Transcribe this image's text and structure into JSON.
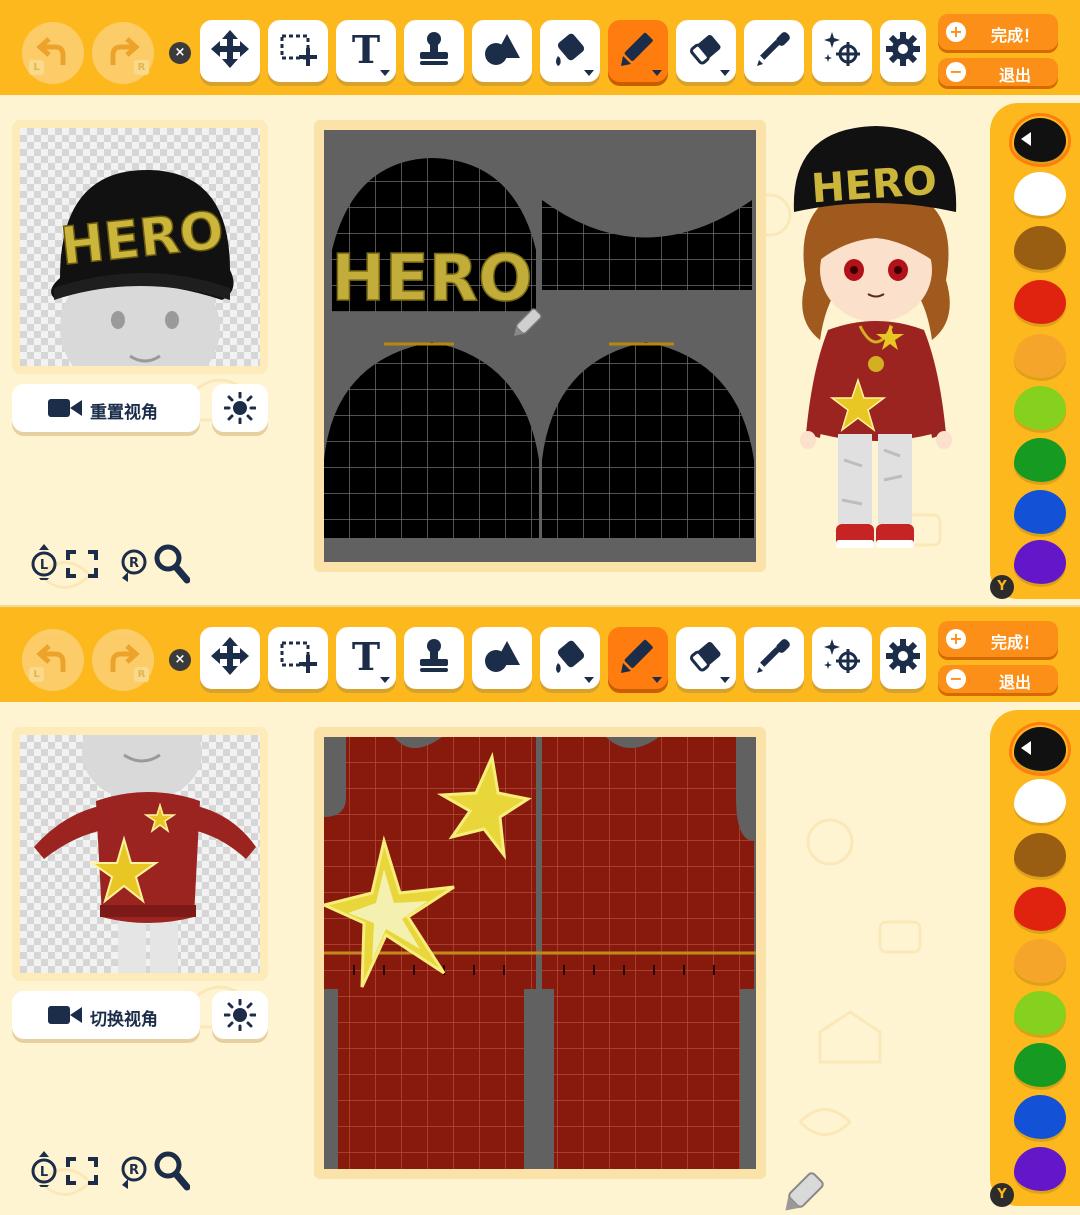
{
  "toolbar": {
    "close_glyph": "×",
    "undo_key": "L",
    "redo_key": "R",
    "tools": [
      {
        "icon": "move-icon"
      },
      {
        "icon": "select-area-icon"
      },
      {
        "icon": "text-icon",
        "glyph": "T"
      },
      {
        "icon": "stamp-icon"
      },
      {
        "icon": "shapes-icon"
      },
      {
        "icon": "fill-bucket-icon"
      },
      {
        "icon": "pencil-icon",
        "active": true
      },
      {
        "icon": "eraser-icon"
      },
      {
        "icon": "eyedropper-icon"
      },
      {
        "icon": "effects-icon"
      },
      {
        "icon": "settings-icon"
      }
    ],
    "done_label": "完成！",
    "exit_label": "退出",
    "done_icon": "+",
    "exit_icon": "−"
  },
  "panels": [
    {
      "view_button_label": "重置视角",
      "zoom_key_left": "L",
      "zoom_key_right": "R",
      "canvas_text": "HERO",
      "preview_text": "HERO",
      "avatar_hat_text": "HERO",
      "palette_hotkey": "Y"
    },
    {
      "view_button_label": "切换视角",
      "zoom_key_left": "L",
      "zoom_key_right": "R",
      "palette_hotkey": "Y"
    }
  ],
  "palette": {
    "colors": [
      "#111111",
      "#ffffff",
      "#9a5e12",
      "#e0230e",
      "#f5a52a",
      "#86d11d",
      "#169a22",
      "#1352d6",
      "#6416c9"
    ],
    "selected_index": 0
  },
  "accent": "#fcb81d",
  "active_tool_color": "#ff7d0f"
}
